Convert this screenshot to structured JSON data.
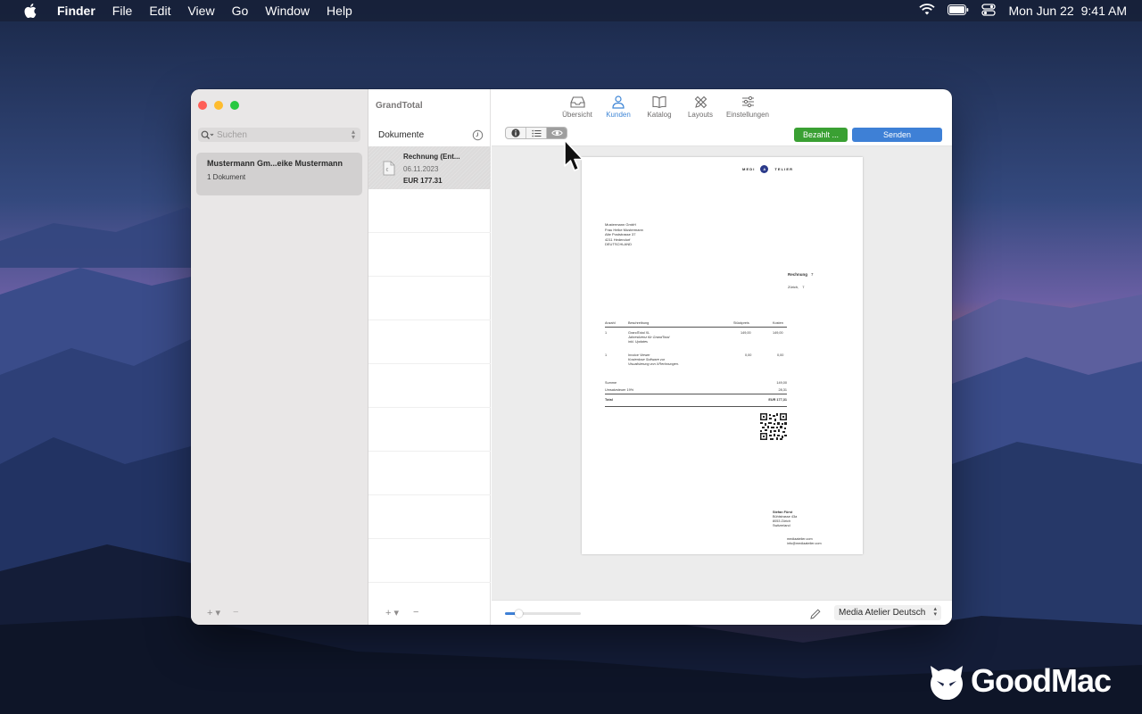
{
  "menubar": {
    "app": "Finder",
    "items": [
      "File",
      "Edit",
      "View",
      "Go",
      "Window",
      "Help"
    ],
    "date": "Mon Jun 22",
    "time": "9:41 AM"
  },
  "window": {
    "app_title": "GrandTotal",
    "tabs": [
      {
        "label": "Übersicht",
        "icon": "inbox-icon"
      },
      {
        "label": "Kunden",
        "icon": "person-icon"
      },
      {
        "label": "Katalog",
        "icon": "book-icon"
      },
      {
        "label": "Layouts",
        "icon": "pencil-ruler-icon"
      },
      {
        "label": "Einstellungen",
        "icon": "sliders-icon"
      }
    ],
    "active_tab": "Kunden",
    "sidebar": {
      "search_placeholder": "Suchen",
      "customer": {
        "name": "Mustermann Gm...eike Mustermann",
        "count": "1 Dokument"
      },
      "footer_add": "+ ▾",
      "footer_remove": "−"
    },
    "documents": {
      "header": "Dokumente",
      "item": {
        "title": "Rechnung (Ent...",
        "date": "06.11.2023",
        "amount": "EUR 177.31"
      },
      "footer_add": "+ ▾",
      "footer_remove": "−"
    },
    "preview_toolbar": {
      "segments": [
        "info-icon",
        "list-icon",
        "eye-icon"
      ],
      "active_segment": "eye-icon",
      "paid_button": "Bezahlt ...",
      "send_button": "Senden",
      "paid_color": "#3aa033",
      "send_color": "#3e80d6"
    },
    "invoice": {
      "logo_left": "M E D I",
      "logo_mark": "A",
      "logo_right": "T E L I E R",
      "address": [
        "Mustermann GmbH",
        "Frau Heike Mustermann",
        "Alte Poststrasse 37",
        "4211 Hedendorf",
        "DEUTSCHLAND"
      ],
      "heading": "Rechnung",
      "heading_value": "7",
      "place": "Zürich,",
      "place_value": "7",
      "columns": [
        "Anzahl",
        "Beschreibung",
        "Stückpreis",
        "Kosten"
      ],
      "rows": [
        {
          "qty": "1",
          "title": "GrandTotal XL",
          "desc1": "Jahreslizenz für GrandTotal",
          "desc2": "inkl. Updates",
          "unit": "149,00",
          "total": "149,00"
        },
        {
          "qty": "1",
          "title": "Invoice Viewer",
          "desc1": "Kostenlose Software zur",
          "desc2": "Visualisierung von XRechnungen.",
          "unit": "0,00",
          "total": "0,00"
        }
      ],
      "sum_label": "Summe",
      "sum_value": "149,00",
      "tax_label": "Umsatzsteuer 19%",
      "tax_value": "28,31",
      "total_label": "Total",
      "total_value": "EUR 177,31",
      "sender": [
        "Stefan Fürst",
        "Bühlstrasse 43a",
        "8053 Zürich",
        "Switzerland"
      ],
      "contact": [
        "mediaatelier.com",
        "info@mediaatelier.com"
      ]
    },
    "bottom": {
      "zoom_level": 0.18,
      "layout_select": "Media Atelier Deutsch"
    }
  },
  "watermark": "GoodMac"
}
